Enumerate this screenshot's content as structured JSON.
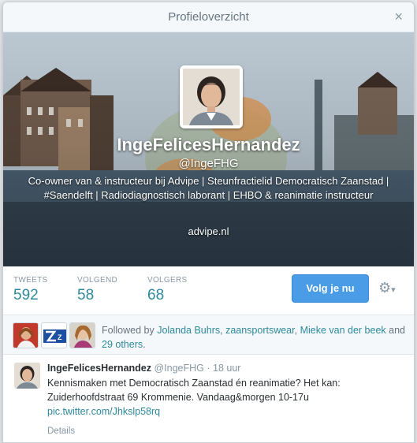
{
  "dialog": {
    "title": "Profieloverzicht",
    "close_glyph": "×"
  },
  "profile": {
    "full_name": "IngeFelicesHernandez",
    "screen_name": "@IngeFHG",
    "bio": "Co-owner van & instructeur bij Advipe | Steunfractielid Democratisch Zaanstad | #Saendelft | Radiodiagnostisch laborant | EHBO & reanimatie instructeur",
    "url": "advipe.nl",
    "avatar_icon": "profile-photo"
  },
  "stats": [
    {
      "label": "TWEETS",
      "value": "592"
    },
    {
      "label": "VOLGEND",
      "value": "58"
    },
    {
      "label": "VOLGERS",
      "value": "68"
    }
  ],
  "actions": {
    "follow_label": "Volg je nu",
    "gear_glyph": "⚙",
    "caret_glyph": "▾"
  },
  "followed_by": {
    "prefix": "Followed by",
    "people": [
      "Jolanda Buhrs",
      "zaansportswear",
      "Mieke van der beek"
    ],
    "sep1": ", ",
    "sep2": ", ",
    "and_text": " and ",
    "others": "29 others",
    "end": "."
  },
  "tweet": {
    "name": "IngeFelicesHernandez",
    "screen_name": "@IngeFHG",
    "time": "· 18 uur",
    "text": "Kennismaken met Democratisch Zaanstad én reanimatie? Het kan: Zuiderhoofdstraat 69 Krommenie. Vandaag&morgen 10-17u ",
    "link": "pic.twitter.com/Jhkslp58rq",
    "details": "Details"
  },
  "colors": {
    "accent": "#2d8a9b",
    "button": "#4a9ce6"
  }
}
